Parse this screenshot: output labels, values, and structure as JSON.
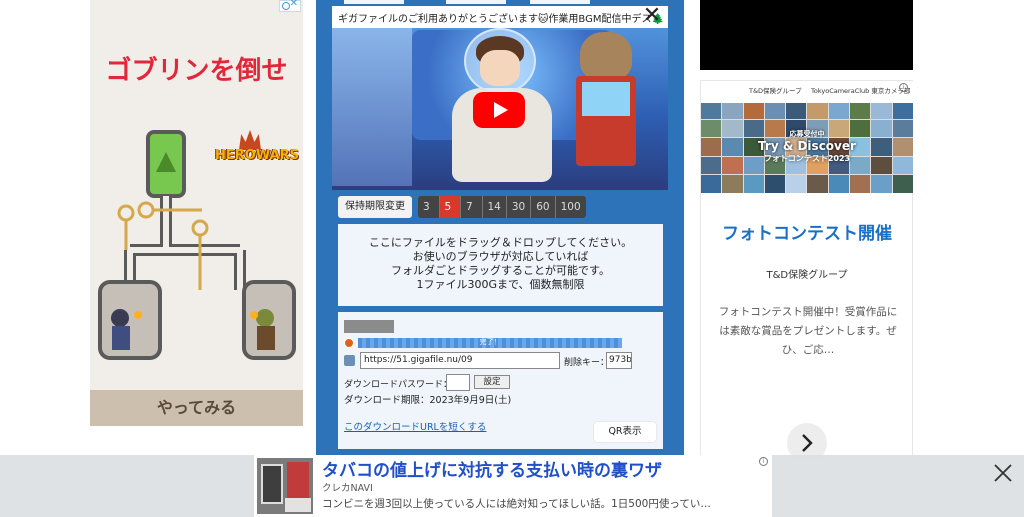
{
  "left_ad": {
    "title": "ゴブリンを倒せ",
    "logo": "HEROWARS",
    "cta": "やってみる"
  },
  "center": {
    "video": {
      "caption": "ギガファイルのご利用ありがとうございます🐱作業用BGM配信中デス🌲"
    },
    "retention": {
      "label": "保持期限変更",
      "options": [
        "3日",
        "5日",
        "7日",
        "14日",
        "30日",
        "60日",
        "100日"
      ],
      "selected": "5日"
    },
    "drop_zone": {
      "line1": "ここにファイルをドラッグ＆ドロップしてください。",
      "line2": "お使いのブラウザが対応していれば",
      "line3": "フォルダごとドラッグすることが可能です。",
      "line4": "1ファイル300Gまで、個数無制限"
    },
    "result": {
      "progress_text": "完了！",
      "progress": 1.0,
      "url_value": "https://51.gigafile.nu/09",
      "delete_key_label": "削除キー：",
      "delete_key_value": "973b",
      "password_label": "ダウンロードパスワード：",
      "password_button": "設定",
      "expiry": "ダウンロード期限：2023年9月9日(土)",
      "shorten_link": "このダウンロードURLを短くする",
      "qr_button": "QR表示"
    }
  },
  "right_ad": {
    "head_left": "T&D保険グループ",
    "head_right": "TokyoCameraClub 東京カメラ部",
    "overlay_line1": "応募受付中",
    "overlay_line2": "Try & Discover",
    "overlay_line3": "フォトコンテスト2023",
    "title": "フォトコンテスト開催",
    "sponsor": "T&D保険グループ",
    "description": "フォトコンテスト開催中！受賞作品には素敵な賞品をプレゼントします。ぜひ、ご応…"
  },
  "bottom_ad": {
    "title": "タバコの値上げに対抗する支払い時の裏ワザ",
    "source": "クレカNAVI",
    "description": "コンビニを週3回以上使っている人には絶対知ってほしい話。1日500円使ってい…"
  }
}
